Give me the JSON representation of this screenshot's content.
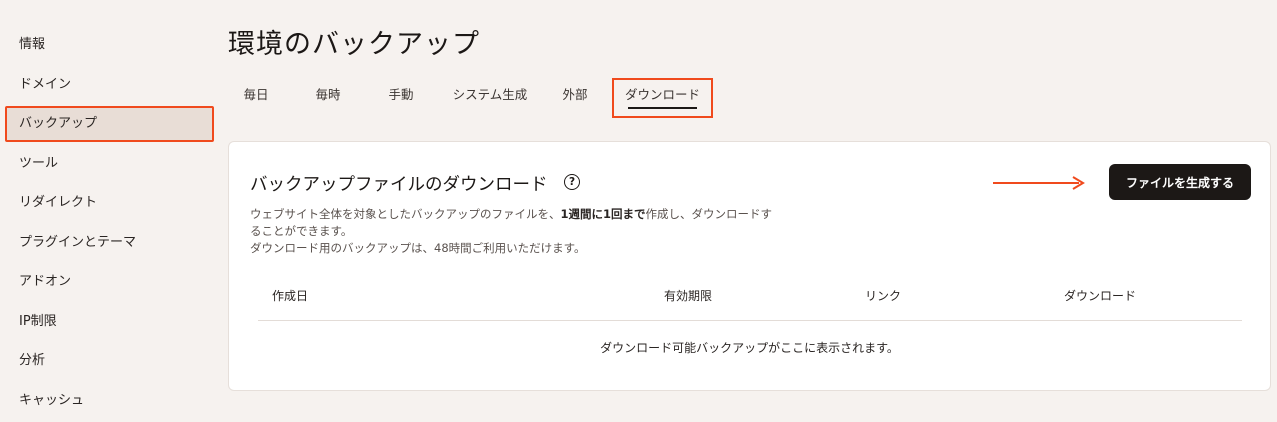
{
  "sidebar": {
    "items": [
      {
        "label": "情報"
      },
      {
        "label": "ドメイン"
      },
      {
        "label": "バックアップ"
      },
      {
        "label": "ツール"
      },
      {
        "label": "リダイレクト"
      },
      {
        "label": "プラグインとテーマ"
      },
      {
        "label": "アドオン"
      },
      {
        "label": "IP制限"
      },
      {
        "label": "分析"
      },
      {
        "label": "キャッシュ"
      }
    ],
    "active_index": 2
  },
  "page_title": "環境のバックアップ",
  "tabs": [
    {
      "label": "毎日"
    },
    {
      "label": "毎時"
    },
    {
      "label": "手動"
    },
    {
      "label": "システム生成"
    },
    {
      "label": "外部"
    },
    {
      "label": "ダウンロード"
    }
  ],
  "active_tab": 5,
  "card": {
    "title": "バックアップファイルのダウンロード",
    "help_icon": "question-circle-icon",
    "desc_part1": "ウェブサイト全体を対象としたバックアップのファイルを、",
    "desc_bold": "1週間に1回まで",
    "desc_part2": "作成し、ダウンロードす",
    "desc_line2": "ることができます。",
    "desc_line3": "ダウンロード用のバックアップは、48時間ご利用いただけます。",
    "generate_button": "ファイルを生成する",
    "arrow_icon": "right-arrow-icon",
    "accent_color": "#f04a1d"
  },
  "table": {
    "columns": [
      "作成日",
      "有効期限",
      "リンク",
      "ダウンロード"
    ],
    "empty_message": "ダウンロード可能バックアップがここに表示されます。"
  }
}
